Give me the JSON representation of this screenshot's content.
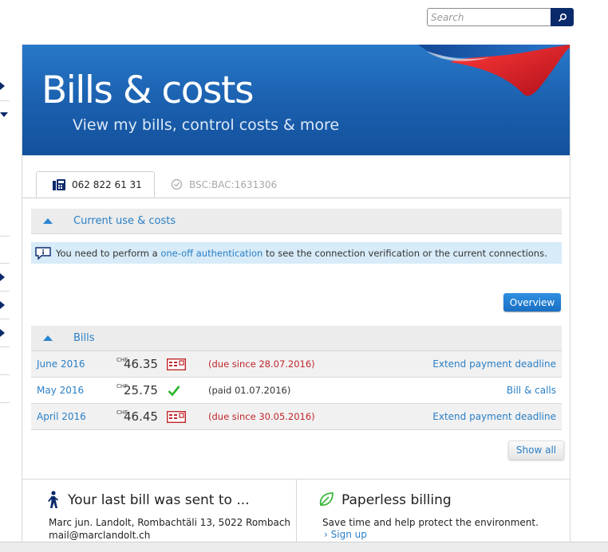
{
  "search": {
    "placeholder": "Search"
  },
  "hero": {
    "title": "Bills & costs",
    "subtitle": "View my bills, control costs & more"
  },
  "tabs": [
    {
      "label": "062 822 61 31",
      "active": true,
      "icon": "phone-icon"
    },
    {
      "label": "BSC:BAC:1631306",
      "active": false,
      "icon": "clock-check-icon"
    }
  ],
  "current_use": {
    "label": "Current use & costs"
  },
  "info": {
    "prefix": "You need to perform a",
    "link": "one-off authentication",
    "suffix": "to see the connection verification or the current connections."
  },
  "overview_button": "Overview",
  "bills": {
    "label": "Bills",
    "currency": "CHF",
    "rows": [
      {
        "month": "June 2016",
        "amount": "46.35",
        "status": "(due since 28.07.2016)",
        "status_type": "overdue",
        "action": "Extend payment deadline"
      },
      {
        "month": "May 2016",
        "amount": "25.75",
        "status": "(paid 01.07.2016)",
        "status_type": "paid",
        "action": "Bill & calls"
      },
      {
        "month": "April 2016",
        "amount": "46.45",
        "status": "(due since 30.05.2016)",
        "status_type": "overdue",
        "action": "Extend payment deadline"
      }
    ],
    "show_all": "Show all"
  },
  "last_bill": {
    "title": "Your last bill was sent to ...",
    "address": "Marc jun. Landolt, Rombachtäli 13, 5022 Rombach",
    "email": "mail@marclandolt.ch"
  },
  "paperless": {
    "title": "Paperless billing",
    "text": "Save time and help protect the environment.",
    "link": "Sign up"
  },
  "colors": {
    "brand_blue": "#1a5fae",
    "link": "#2a7fc6",
    "overdue": "#c0262c",
    "paid": "#2bb52b",
    "navy": "#0b2a6b"
  }
}
